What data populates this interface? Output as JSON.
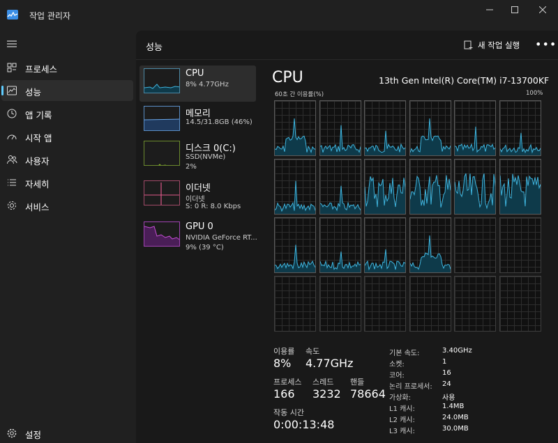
{
  "window": {
    "title": "작업 관리자"
  },
  "sidebar": {
    "items": [
      {
        "label": "프로세스",
        "icon": "processes-icon"
      },
      {
        "label": "성능",
        "icon": "performance-icon"
      },
      {
        "label": "앱 기록",
        "icon": "app-history-icon"
      },
      {
        "label": "시작 앱",
        "icon": "startup-apps-icon"
      },
      {
        "label": "사용자",
        "icon": "users-icon"
      },
      {
        "label": "자세히",
        "icon": "details-icon"
      },
      {
        "label": "서비스",
        "icon": "services-icon"
      }
    ],
    "settings_label": "설정",
    "active_index": 1
  },
  "header": {
    "title": "성능",
    "new_task_label": "새 작업 실행",
    "more_label": "•••"
  },
  "perf_list": [
    {
      "name": "CPU",
      "line1": "8% 4.77GHz",
      "line2": "",
      "color": "#4cc2ff"
    },
    {
      "name": "메모리",
      "line1": "14.5/31.8GB (46%)",
      "line2": "",
      "color": "#5b9bd5"
    },
    {
      "name": "디스크 0(C:)",
      "line1": "SSD(NVMe)",
      "line2": "2%",
      "color": "#8cbf26"
    },
    {
      "name": "이더넷",
      "line1": "이더넷",
      "line2": "S: 0 R: 8.0 Kbps",
      "color": "#e05a8a"
    },
    {
      "name": "GPU 0",
      "line1": "NVIDIA GeForce RT...",
      "line2": "9% (39 °C)",
      "color": "#c44fd4"
    }
  ],
  "detail": {
    "title": "CPU",
    "model": "13th Gen Intel(R) Core(TM) i7-13700KF",
    "axis_left": "60초 간 이용률(%)",
    "axis_right": "100%",
    "colors": {
      "line": "#3fb6e0",
      "fill": "#0e3a4a"
    }
  },
  "stats": {
    "utilization_label": "이용률",
    "utilization": "8%",
    "speed_label": "속도",
    "speed": "4.77GHz",
    "processes_label": "프로세스",
    "processes": "166",
    "threads_label": "스레드",
    "threads": "3232",
    "handles_label": "핸들",
    "handles": "78664",
    "uptime_label": "작동 시간",
    "uptime": "0:00:13:48"
  },
  "specs": [
    {
      "key": "기본 속도:",
      "value": "3.40GHz"
    },
    {
      "key": "소켓:",
      "value": "1"
    },
    {
      "key": "코어:",
      "value": "16"
    },
    {
      "key": "논리 프로세서:",
      "value": "24"
    },
    {
      "key": "가상화:",
      "value": "사용"
    },
    {
      "key": "L1 캐시:",
      "value": "1.4MB"
    },
    {
      "key": "L2 캐시:",
      "value": "24.0MB"
    },
    {
      "key": "L3 캐시:",
      "value": "30.0MB"
    }
  ]
}
